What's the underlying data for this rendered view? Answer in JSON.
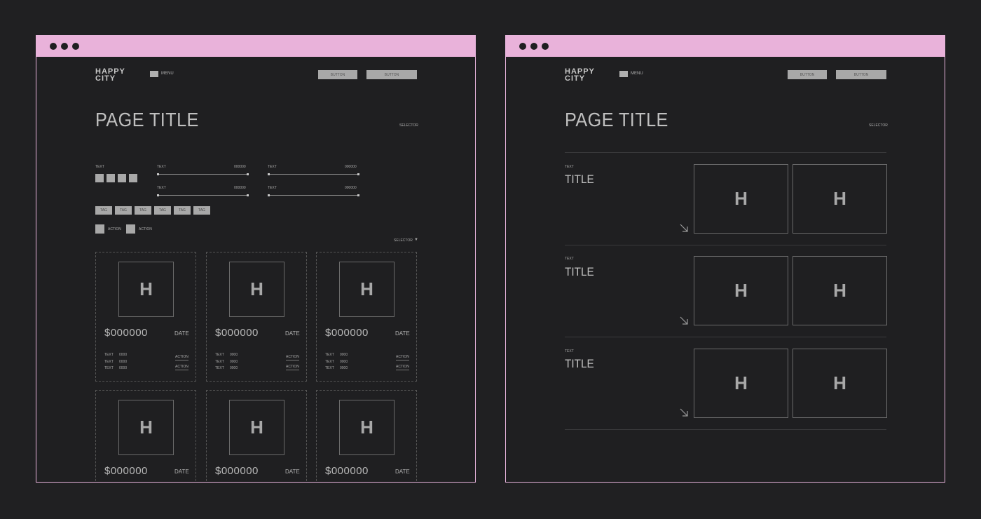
{
  "logo": {
    "line1": "HAPPY",
    "line2": "CITY"
  },
  "nav": {
    "menu_label": "MENU",
    "button1": "BUTTON",
    "button2": "BUTTON"
  },
  "page": {
    "title": "PAGE TITLE",
    "selector": "SELECTOR"
  },
  "filters": {
    "text_label": "TEXT",
    "sliders": [
      {
        "label": "TEXT",
        "value": "000000"
      },
      {
        "label": "TEXT",
        "value": "000000"
      },
      {
        "label": "TEXT",
        "value": "000000"
      },
      {
        "label": "TEXT",
        "value": "000000"
      }
    ],
    "tags": [
      "TAG",
      "TAG",
      "TAG",
      "TAG",
      "TAG",
      "TAG"
    ],
    "actions": [
      "ACTION",
      "ACTION"
    ],
    "sort_selector": "SELECTOR"
  },
  "cards": [
    {
      "icon": "H",
      "price": "$000000",
      "date": "DATE"
    },
    {
      "icon": "H",
      "price": "$000000",
      "date": "DATE"
    },
    {
      "icon": "H",
      "price": "$000000",
      "date": "DATE"
    },
    {
      "icon": "H",
      "price": "$000000",
      "date": "DATE"
    },
    {
      "icon": "H",
      "price": "$000000",
      "date": "DATE"
    },
    {
      "icon": "H",
      "price": "$000000",
      "date": "DATE"
    }
  ],
  "card_rows": {
    "text": "TEXT",
    "value": "0000",
    "action": "ACTION"
  },
  "sections": [
    {
      "text": "TEXT",
      "title": "TITLE",
      "icons": [
        "H",
        "H"
      ]
    },
    {
      "text": "TEXT",
      "title": "TITLE",
      "icons": [
        "H",
        "H"
      ]
    },
    {
      "text": "TEXT",
      "title": "TITLE",
      "icons": [
        "H",
        "H"
      ]
    }
  ],
  "colors": {
    "titlebar": "#e9b2da",
    "background": "#202022",
    "window": "#1f1f21"
  }
}
